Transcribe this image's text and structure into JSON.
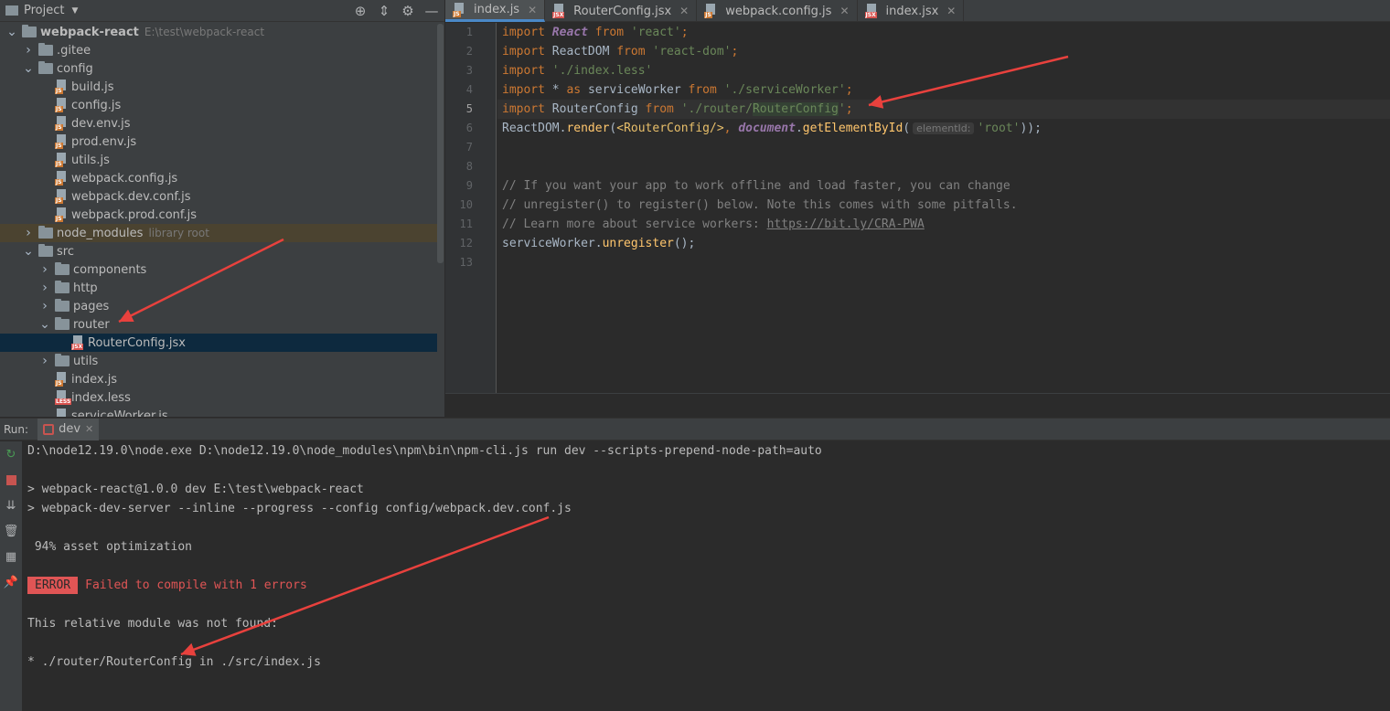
{
  "project_panel": {
    "title": "Project",
    "tools": [
      "target-icon",
      "collapse-icon",
      "gear-icon",
      "minimize-icon"
    ],
    "tree": [
      {
        "depth": 0,
        "type": "folder",
        "expanded": true,
        "label": "webpack-react",
        "path": "E:\\test\\webpack-react",
        "bold": true
      },
      {
        "depth": 1,
        "type": "folder",
        "expanded": false,
        "label": ".gitee"
      },
      {
        "depth": 1,
        "type": "folder",
        "expanded": true,
        "label": "config"
      },
      {
        "depth": 2,
        "type": "file",
        "ext": "JS",
        "label": "build.js"
      },
      {
        "depth": 2,
        "type": "file",
        "ext": "JS",
        "label": "config.js"
      },
      {
        "depth": 2,
        "type": "file",
        "ext": "JS",
        "label": "dev.env.js"
      },
      {
        "depth": 2,
        "type": "file",
        "ext": "JS",
        "label": "prod.env.js"
      },
      {
        "depth": 2,
        "type": "file",
        "ext": "JS",
        "label": "utils.js"
      },
      {
        "depth": 2,
        "type": "file",
        "ext": "JS",
        "label": "webpack.config.js"
      },
      {
        "depth": 2,
        "type": "file",
        "ext": "JS",
        "label": "webpack.dev.conf.js"
      },
      {
        "depth": 2,
        "type": "file",
        "ext": "JS",
        "label": "webpack.prod.conf.js"
      },
      {
        "depth": 1,
        "type": "folder",
        "expanded": false,
        "label": "node_modules",
        "path": "library root",
        "library": true
      },
      {
        "depth": 1,
        "type": "folder",
        "expanded": true,
        "label": "src"
      },
      {
        "depth": 2,
        "type": "folder",
        "expanded": false,
        "label": "components"
      },
      {
        "depth": 2,
        "type": "folder",
        "expanded": false,
        "label": "http"
      },
      {
        "depth": 2,
        "type": "folder",
        "expanded": false,
        "label": "pages"
      },
      {
        "depth": 2,
        "type": "folder",
        "expanded": true,
        "label": "router"
      },
      {
        "depth": 3,
        "type": "file",
        "ext": "JSX",
        "label": "RouterConfig.jsx",
        "selected": true
      },
      {
        "depth": 2,
        "type": "folder",
        "expanded": false,
        "label": "utils"
      },
      {
        "depth": 2,
        "type": "file",
        "ext": "JS",
        "label": "index.js"
      },
      {
        "depth": 2,
        "type": "file",
        "ext": "LESS",
        "label": "index.less"
      },
      {
        "depth": 2,
        "type": "file",
        "ext": "JS",
        "label": "serviceWorker.js"
      }
    ]
  },
  "editor": {
    "tabs": [
      {
        "label": "index.js",
        "ext": "JS",
        "active": true
      },
      {
        "label": "RouterConfig.jsx",
        "ext": "JSX",
        "active": false
      },
      {
        "label": "webpack.config.js",
        "ext": "JS",
        "active": false
      },
      {
        "label": "index.jsx",
        "ext": "JSX",
        "active": false
      }
    ],
    "current_line": 5,
    "lines": [
      [
        [
          "kw",
          "import "
        ],
        [
          "ital",
          "React"
        ],
        [
          "kw",
          " from "
        ],
        [
          "str",
          "'react'"
        ],
        [
          "kw",
          ";"
        ]
      ],
      [
        [
          "kw",
          "import "
        ],
        [
          "",
          "ReactDOM"
        ],
        [
          "kw",
          " from "
        ],
        [
          "str",
          "'react-dom'"
        ],
        [
          "kw",
          ";"
        ]
      ],
      [
        [
          "kw",
          "import "
        ],
        [
          "str",
          "'./index.less'"
        ]
      ],
      [
        [
          "kw",
          "import "
        ],
        [
          "",
          "* "
        ],
        [
          "kw",
          "as "
        ],
        [
          "",
          "serviceWorker"
        ],
        [
          "kw",
          " from "
        ],
        [
          "str",
          "'./serviceWorker'"
        ],
        [
          "kw",
          ";"
        ]
      ],
      [
        [
          "kw",
          "import "
        ],
        [
          "",
          "RouterConfig"
        ],
        [
          "kw",
          " from "
        ],
        [
          "str",
          "'./router/"
        ],
        [
          "strhl",
          "RouterConfig"
        ],
        [
          "str",
          "'"
        ],
        [
          "kw",
          ";"
        ]
      ],
      [
        [
          "",
          "ReactDOM."
        ],
        [
          "fn",
          "render"
        ],
        [
          "",
          "("
        ],
        [
          "tag",
          "<RouterConfig/>"
        ],
        [
          "kw",
          ", "
        ],
        [
          "ital",
          "document"
        ],
        [
          "",
          "."
        ],
        [
          "fn",
          "getElementById"
        ],
        [
          "",
          "("
        ],
        [
          "hint",
          "elementId:"
        ],
        [
          "str",
          "'root'"
        ],
        [
          "",
          "));"
        ]
      ],
      [],
      [],
      [
        [
          "cmt",
          "// If you want your app to work offline and load faster, you can change"
        ]
      ],
      [
        [
          "cmt",
          "// unregister() to register() below. Note this comes with some pitfalls."
        ]
      ],
      [
        [
          "cmt",
          "// Learn more about service workers: "
        ],
        [
          "link",
          "https://bit.ly/CRA-PWA"
        ]
      ],
      [
        [
          "",
          "serviceWorker."
        ],
        [
          "fn",
          "unregister"
        ],
        [
          "",
          "();"
        ]
      ],
      []
    ]
  },
  "run_panel": {
    "label": "Run:",
    "tab_label": "dev",
    "toolbar": [
      "rerun-icon",
      "stop-icon",
      "scroll-to-end-icon",
      "trash-icon",
      "layout-icon",
      "pin-icon"
    ],
    "console": [
      {
        "text": "D:\\node12.19.0\\node.exe D:\\node12.19.0\\node_modules\\npm\\bin\\npm-cli.js run dev --scripts-prepend-node-path=auto"
      },
      {
        "text": ""
      },
      {
        "text": "> webpack-react@1.0.0 dev E:\\test\\webpack-react"
      },
      {
        "text": "> webpack-dev-server --inline --progress --config config/webpack.dev.conf.js"
      },
      {
        "text": ""
      },
      {
        "text": " 94% asset optimization"
      },
      {
        "text": ""
      },
      {
        "badge": "ERROR",
        "text": "Failed to compile with 1 errors",
        "error": true
      },
      {
        "text": ""
      },
      {
        "text": "This relative module was not found:"
      },
      {
        "text": ""
      },
      {
        "text": "* ./router/RouterConfig in ./src/index.js"
      }
    ]
  }
}
